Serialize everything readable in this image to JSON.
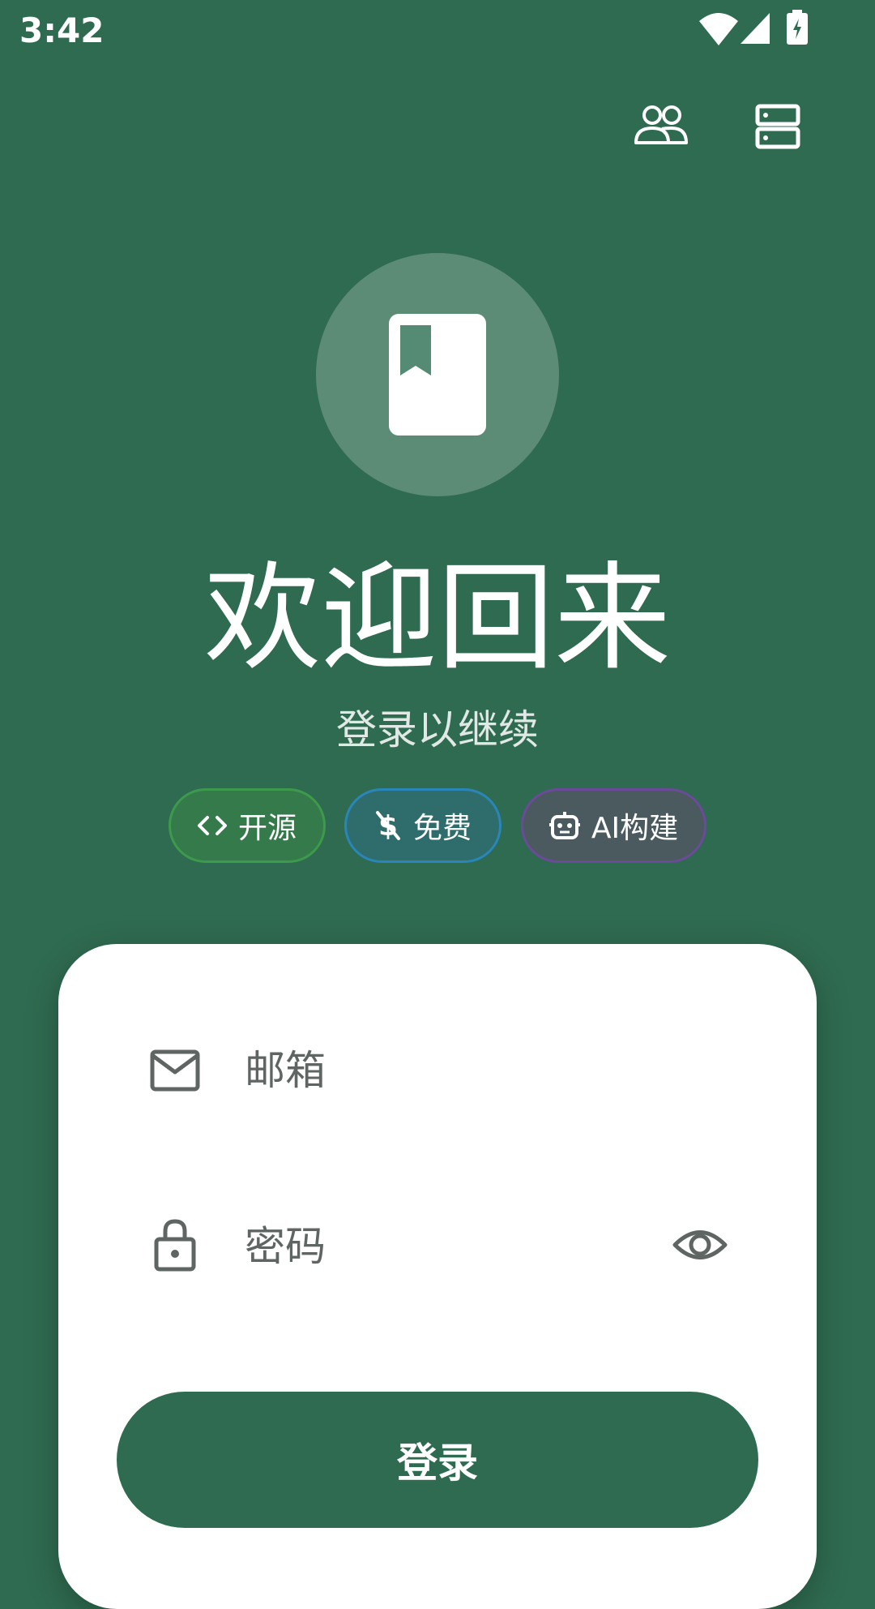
{
  "status_bar": {
    "time": "3:42",
    "icons": [
      "wifi-icon",
      "cellular-signal-icon",
      "battery-charging-icon"
    ]
  },
  "top_actions": {
    "icons": [
      "users-icon",
      "server-icon"
    ]
  },
  "logo": {
    "icon": "book-icon"
  },
  "header": {
    "title": "欢迎回来",
    "subtitle": "登录以继续"
  },
  "chips": [
    {
      "label": "开源",
      "icon": "code-icon",
      "border_color": "#3d9a4c"
    },
    {
      "label": "免费",
      "icon": "no-money-icon",
      "border_color": "#2a86b8"
    },
    {
      "label": "AI构建",
      "icon": "robot-icon",
      "border_color": "#6c4a9a"
    }
  ],
  "form": {
    "email": {
      "placeholder": "邮箱",
      "value": "",
      "icon": "mail-icon"
    },
    "password": {
      "placeholder": "密码",
      "value": "",
      "icon": "lock-icon",
      "toggle_icon": "eye-icon"
    },
    "submit_label": "登录"
  },
  "colors": {
    "background": "#2f6b50",
    "card": "#ffffff",
    "primary": "#2f6b50",
    "field_text": "#5f6563"
  }
}
